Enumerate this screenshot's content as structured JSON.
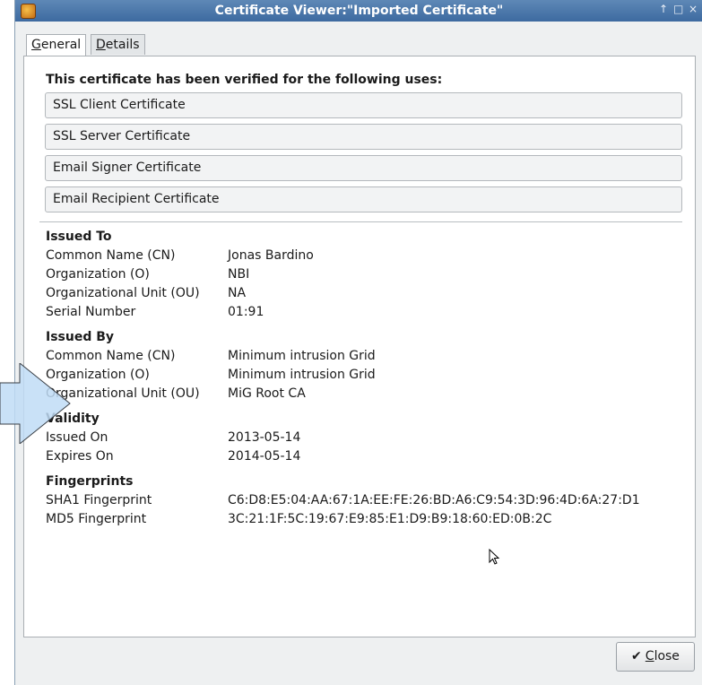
{
  "window": {
    "title": "Certificate Viewer:\"Imported Certificate\"",
    "controls": [
      "↑",
      "□",
      "×"
    ]
  },
  "tabs": [
    {
      "label_pre": "G",
      "label_rest": "eneral"
    },
    {
      "label_pre": "D",
      "label_rest": "etails"
    }
  ],
  "uses": {
    "heading": "This certificate has been verified for the following uses:",
    "items": [
      "SSL Client Certificate",
      "SSL Server Certificate",
      "Email Signer Certificate",
      "Email Recipient Certificate"
    ]
  },
  "issued_to": {
    "title": "Issued To",
    "rows": [
      {
        "label": "Common Name (CN)",
        "value": "Jonas Bardino"
      },
      {
        "label": "Organization (O)",
        "value": "NBI"
      },
      {
        "label": "Organizational Unit (OU)",
        "value": "NA"
      },
      {
        "label": "Serial Number",
        "value": "01:91"
      }
    ]
  },
  "issued_by": {
    "title": "Issued By",
    "rows": [
      {
        "label": "Common Name (CN)",
        "value": "Minimum intrusion Grid"
      },
      {
        "label": "Organization (O)",
        "value": "Minimum intrusion Grid"
      },
      {
        "label": "Organizational Unit (OU)",
        "value": "MiG Root CA"
      }
    ]
  },
  "validity": {
    "title": "Validity",
    "rows": [
      {
        "label": "Issued On",
        "value": "2013-05-14"
      },
      {
        "label": "Expires On",
        "value": "2014-05-14"
      }
    ]
  },
  "fingerprints": {
    "title": "Fingerprints",
    "rows": [
      {
        "label": "SHA1 Fingerprint",
        "value": "C6:D8:E5:04:AA:67:1A:EE:FE:26:BD:A6:C9:54:3D:96:4D:6A:27:D1"
      },
      {
        "label": "MD5 Fingerprint",
        "value": "3C:21:1F:5C:19:67:E9:85:E1:D9:B9:18:60:ED:0B:2C"
      }
    ]
  },
  "close_button": {
    "label_pre": "C",
    "label_rest": "lose",
    "icon": "check-icon"
  }
}
